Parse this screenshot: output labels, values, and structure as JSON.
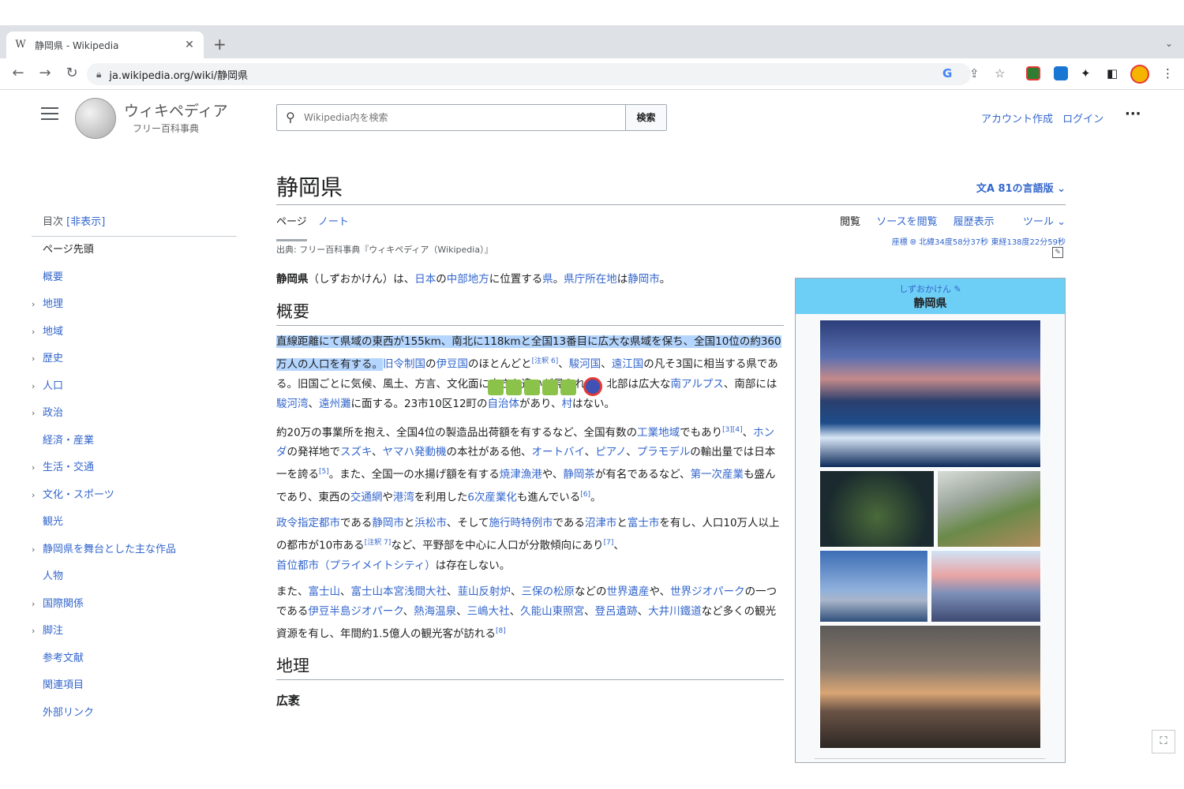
{
  "browser": {
    "tab_title": "静岡県 - Wikipedia",
    "tab_favicon": "W",
    "url": "ja.wikipedia.org/wiki/静岡県"
  },
  "header": {
    "logo_title": "ウィキペディア",
    "logo_tagline": "フリー百科事典",
    "search_placeholder": "Wikipedia内を検索",
    "search_button": "検索",
    "create_account": "アカウント作成",
    "login": "ログイン"
  },
  "toc": {
    "heading": "目次",
    "toggle": "[非表示]",
    "items": [
      {
        "label": "ページ先頭",
        "expandable": false
      },
      {
        "label": "概要",
        "expandable": false
      },
      {
        "label": "地理",
        "expandable": true
      },
      {
        "label": "地域",
        "expandable": true
      },
      {
        "label": "歴史",
        "expandable": true
      },
      {
        "label": "人口",
        "expandable": true
      },
      {
        "label": "政治",
        "expandable": true
      },
      {
        "label": "経済・産業",
        "expandable": false
      },
      {
        "label": "生活・交通",
        "expandable": true
      },
      {
        "label": "文化・スポーツ",
        "expandable": true
      },
      {
        "label": "観光",
        "expandable": false
      },
      {
        "label": "静岡県を舞台とした主な作品",
        "expandable": true
      },
      {
        "label": "人物",
        "expandable": false
      },
      {
        "label": "国際関係",
        "expandable": true
      },
      {
        "label": "脚注",
        "expandable": true
      },
      {
        "label": "参考文献",
        "expandable": false
      },
      {
        "label": "関連項目",
        "expandable": false
      },
      {
        "label": "外部リンク",
        "expandable": false
      }
    ]
  },
  "article": {
    "title": "静岡県",
    "languages": "81の言語版",
    "tab_page": "ページ",
    "tab_talk": "ノート",
    "action_read": "閲覧",
    "action_source": "ソースを閲覧",
    "action_history": "履歴表示",
    "action_tools": "ツール",
    "coord_label": "座標",
    "coord_value": "北緯34度58分37秒 東経138度22分59秒",
    "from": "出典: フリー百科事典『ウィキペディア（Wikipedia）』",
    "lead": {
      "bold": "静岡県",
      "t1": "（しずおかけん）は、",
      "l1": "日本",
      "t2": "の",
      "l2": "中部地方",
      "t3": "に位置する",
      "l3": "県",
      "t4": "。",
      "l4": "県庁所在地",
      "t5": "は",
      "l5": "静岡市",
      "t6": "。"
    },
    "section_overview": "概要",
    "p1": {
      "hl": "直線距離にて県域の東西が155km、南北に118kmと全国13番目に広大な県域を保ち、全国10位の約360万人の人口を有する。",
      "t1": "旧令制国",
      "t2": "の",
      "l1": "伊豆国",
      "t3": "のほとんどと",
      "s1": "[注釈 6]",
      "t4": "、",
      "l2": "駿河国",
      "t5": "、",
      "l3": "遠江国",
      "t6": "の凡そ3国に相当する県である。旧国ごとに気候、風土、方言、文化面に大きな違いが見られる。北部は広大な",
      "l4": "南アルプス",
      "t7": "、南部には",
      "l5": "駿河湾",
      "t8": "、",
      "l6": "遠州灘",
      "t9": "に面する。23市10区12町の",
      "l7": "自治体",
      "t10": "があり、",
      "l8": "村",
      "t11": "はない。"
    },
    "p2": {
      "t1": "約20万の事業所を抱え、全国4位の製造品出荷額を有するなど、全国有数の",
      "l1": "工業地域",
      "t2": "でもあり",
      "s1": "[3][4]",
      "t3": "、",
      "l2": "ホンダ",
      "t4": "の発祥地で",
      "l3": "スズキ",
      "t5": "、",
      "l4": "ヤマハ発動機",
      "t6": "の本社がある他、",
      "l5": "オートバイ",
      "t7": "、",
      "l6": "ピアノ",
      "t8": "、",
      "l7": "プラモデル",
      "t9": "の輸出量では日本一を誇る",
      "s2": "[5]",
      "t10": "。また、全国一の水揚げ額を有する",
      "l8": "焼津漁港",
      "t11": "や、",
      "l9": "静岡茶",
      "t12": "が有名であるなど、",
      "l10": "第一次産業",
      "t13": "も盛んであり、東西の",
      "l11": "交通網",
      "t14": "や",
      "l12": "港湾",
      "t15": "を利用した",
      "l13": "6次産業化",
      "t16": "も進んでいる",
      "s3": "[6]",
      "t17": "。"
    },
    "p3": {
      "l1": "政令指定都市",
      "t1": "である",
      "l2": "静岡市",
      "t2": "と",
      "l3": "浜松市",
      "t3": "、そして",
      "l4": "施行時特例市",
      "t4": "である",
      "l5": "沼津市",
      "t5": "と",
      "l6": "富士市",
      "t6": "を有し、人口10万人以上の都市が10市ある",
      "s1": "[注釈 7]",
      "t7": "など、平野部を中心に人口が分散傾向にあり",
      "s2": "[7]",
      "t8": "、",
      "l7": "首位都市（プライメイトシティ）",
      "t9": "は存在しない。"
    },
    "p4": {
      "t1": "また、",
      "l1": "富士山",
      "t2": "、",
      "l2": "富士山本宮浅間大社",
      "t3": "、",
      "l3": "韮山反射炉",
      "t4": "、",
      "l4": "三保の松原",
      "t5": "などの",
      "l5": "世界遺産",
      "t6": "や、",
      "l6": "世界ジオパーク",
      "t7": "の一つである",
      "l7": "伊豆半島ジオパーク",
      "t8": "、",
      "l8": "熱海温泉",
      "t9": "、",
      "l9": "三嶋大社",
      "t10": "、",
      "l10": "久能山東照宮",
      "t11": "、",
      "l11": "登呂遺跡",
      "t12": "、",
      "l12": "大井川鐵道",
      "t13": "など多くの観光資源を有し、年間約1.5億人の観光客が訪れる",
      "s1": "[8]",
      "t14": ""
    },
    "section_geo": "地理",
    "sub_area": "広袤"
  },
  "infobox": {
    "kana": "しずおかけん",
    "name": "静岡県"
  },
  "colors": {
    "link": "#3366cc",
    "infobox_header": "#6ecff6",
    "selection": "#b4d5fe"
  },
  "icons": [
    "back-icon",
    "forward-icon",
    "reload-icon",
    "lock-icon",
    "google-icon",
    "share-icon",
    "bookmark-star-icon",
    "extension-icon",
    "sidepanel-icon",
    "menu-dots-icon",
    "hamburger-icon",
    "search-icon",
    "translate-icon",
    "globe-icon",
    "edit-pencil-icon",
    "fullscreen-icon"
  ]
}
